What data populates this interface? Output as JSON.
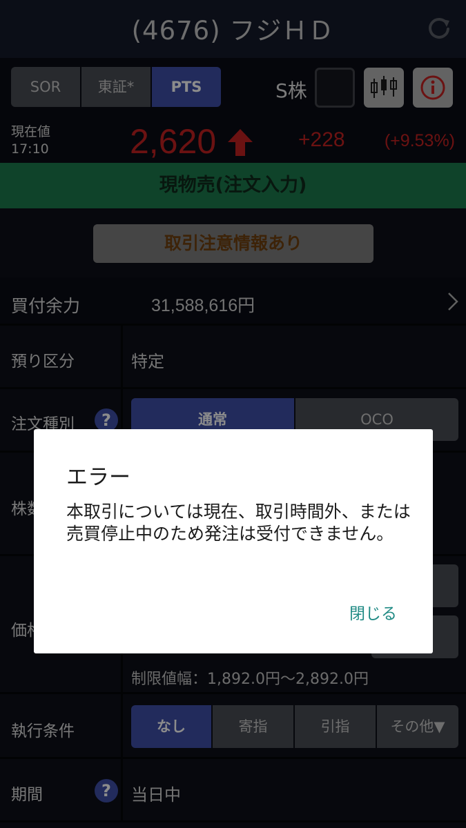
{
  "header": {
    "title": "(4676) フジＨＤ"
  },
  "market": {
    "tabs": [
      {
        "label": "SOR"
      },
      {
        "label": "東証*"
      },
      {
        "label": "PTS"
      }
    ],
    "active_tab": "PTS",
    "skabu_label": "S株"
  },
  "quote": {
    "label_line1": "現在値",
    "label_line2": "17:10",
    "price": "2,620",
    "change": "+228",
    "change_pct": "(+9.53%)",
    "up_color": "#c42222"
  },
  "order_bar": {
    "label": "現物売(注文入力)"
  },
  "caution": {
    "label": "取引注意情報あり"
  },
  "form": {
    "funds": {
      "label": "買付余力",
      "value": "31,588,616円"
    },
    "account": {
      "label": "預り区分",
      "value": "特定"
    },
    "order_type": {
      "label": "注文種別",
      "options": [
        {
          "label": "通常"
        },
        {
          "label": "OCO"
        }
      ],
      "selected": "通常"
    },
    "quantity": {
      "label": "株数"
    },
    "price": {
      "label": "価格",
      "limit_text": "制限値幅：1,892.0円〜2,892.0円"
    },
    "exec": {
      "label": "執行条件",
      "options": [
        {
          "label": "なし"
        },
        {
          "label": "寄指"
        },
        {
          "label": "引指"
        },
        {
          "label": "その他▼"
        }
      ],
      "selected": "なし"
    },
    "period": {
      "label": "期間",
      "value": "当日中"
    }
  },
  "dialog": {
    "title": "エラー",
    "message": "本取引については現在、取引時間外、または売買停止中のため発注は受付できません。",
    "close_label": "閉じる"
  },
  "colors": {
    "accent_blue": "#3e4fa8",
    "order_green": "#1d7a4e",
    "close_teal": "#1f8a84"
  }
}
